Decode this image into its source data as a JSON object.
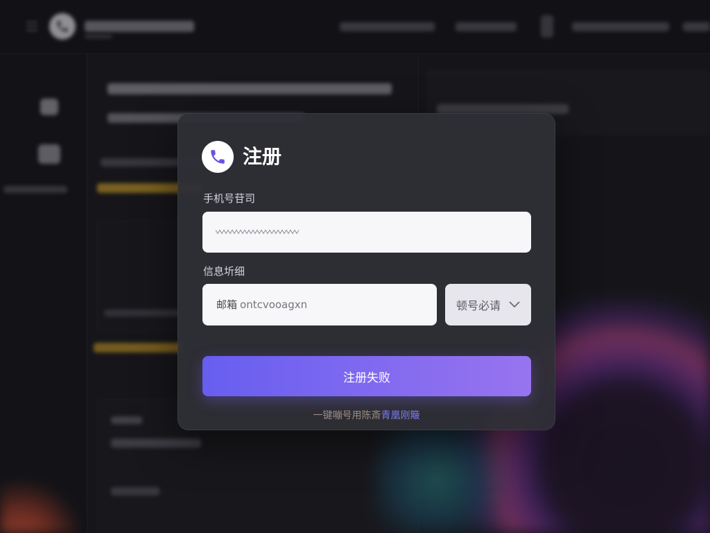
{
  "modal": {
    "title": "注册",
    "phone_label": "手机号苷司",
    "verify_label": "信息圻细",
    "email_prefix": "邮箱",
    "email_placeholder": "ontcvooagxn",
    "code_select_value": "顿号必请",
    "submit_label": "注册失败",
    "footer_text": "一键嘣号用陈斎",
    "footer_link": "青凰刚簸"
  },
  "icons": {
    "modal_logo": "phone-icon",
    "select_arrow": "chevron-down-icon",
    "app_logo": "phone-icon",
    "app_menu": "menu-icon"
  },
  "colors": {
    "background": "#19191e",
    "modal_bg": "#2e2e36",
    "accent_start": "#675ef0",
    "accent_end": "#9874ef",
    "link": "#7d7cf0",
    "highlight_text": "#b08a2a"
  }
}
